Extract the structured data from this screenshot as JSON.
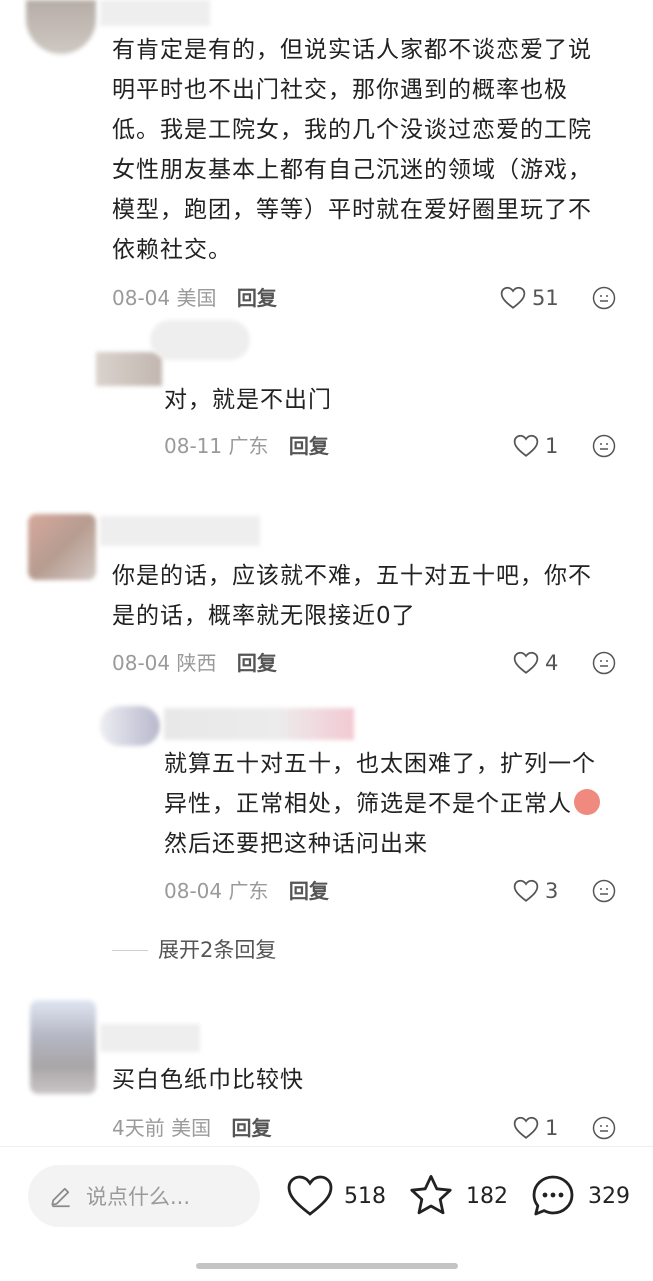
{
  "comments": [
    {
      "text_lines": [
        "有肯定是有的，但说实话人家都不谈恋爱了说",
        "明平时也不出门社交，那你遇到的概率也极",
        "低。我是工院女，我的几个没谈过恋爱的工院",
        "女性朋友基本上都有自己沉迷的领域（游戏，",
        "模型，跑团，等等）平时就在爱好圈里玩了不",
        "依赖社交。"
      ],
      "date": "08-04",
      "location": "美国",
      "reply": "回复",
      "likes": "51"
    },
    {
      "text_lines": [
        "对，就是不出门"
      ],
      "date": "08-11",
      "location": "广东",
      "reply": "回复",
      "likes": "1"
    },
    {
      "text_lines": [
        "你是的话，应该就不难，五十对五十吧，你不",
        "是的话，概率就无限接近0了"
      ],
      "date": "08-04",
      "location": "陕西",
      "reply": "回复",
      "likes": "4"
    },
    {
      "text_lines": [
        "就算五十对五十，也太困难了，扩列一个",
        "异性，正常相处，筛选是不是个正常人",
        "然后还要把这种话问出来"
      ],
      "date": "08-04",
      "location": "广东",
      "reply": "回复",
      "likes": "3"
    },
    {
      "text_lines": [
        "买白色纸巾比较快"
      ],
      "date": "4天前",
      "location": "美国",
      "reply": "回复",
      "likes": "1"
    }
  ],
  "expand_replies": "展开2条回复",
  "bottom_bar": {
    "input_placeholder": "说点什么...",
    "likes": "518",
    "favorites": "182",
    "comments": "329"
  },
  "icons": [
    "heart-icon",
    "emoji-icon",
    "pencil-icon",
    "star-icon",
    "chat-bubble-icon"
  ],
  "colors": {
    "text": "#222222",
    "meta": "#9a9a9a",
    "reply": "#555555",
    "input_bg": "#f3f3f3"
  }
}
